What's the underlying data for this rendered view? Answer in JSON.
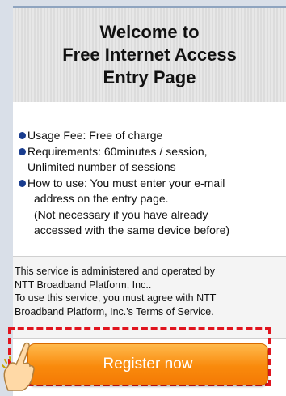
{
  "header": {
    "title_lines": [
      "Welcome to",
      "Free Internet Access",
      "Entry Page"
    ]
  },
  "info": {
    "items": [
      {
        "lines": [
          "Usage Fee: Free of charge"
        ]
      },
      {
        "lines": [
          "Requirements: 60minutes / session,",
          "Unlimited number of sessions"
        ]
      },
      {
        "lines": [
          "How to use: You must enter your e-mail",
          "address on the entry page.",
          "(Not necessary if you have already",
          "accessed with the same device before)"
        ]
      }
    ]
  },
  "admin": {
    "lines": [
      "This service is administered and operated by",
      "NTT Broadband Platform, Inc..",
      "To use this service, you must agree with NTT",
      "Broadband Platform, Inc.'s Terms of Service."
    ]
  },
  "register": {
    "label": "Register now"
  },
  "icons": {
    "bullet": "bullet-dot-icon",
    "pointer": "pointing-hand-icon"
  },
  "colors": {
    "bullet": "#1a3d8f",
    "button": "#f98a0c",
    "highlight": "#e0141e"
  }
}
